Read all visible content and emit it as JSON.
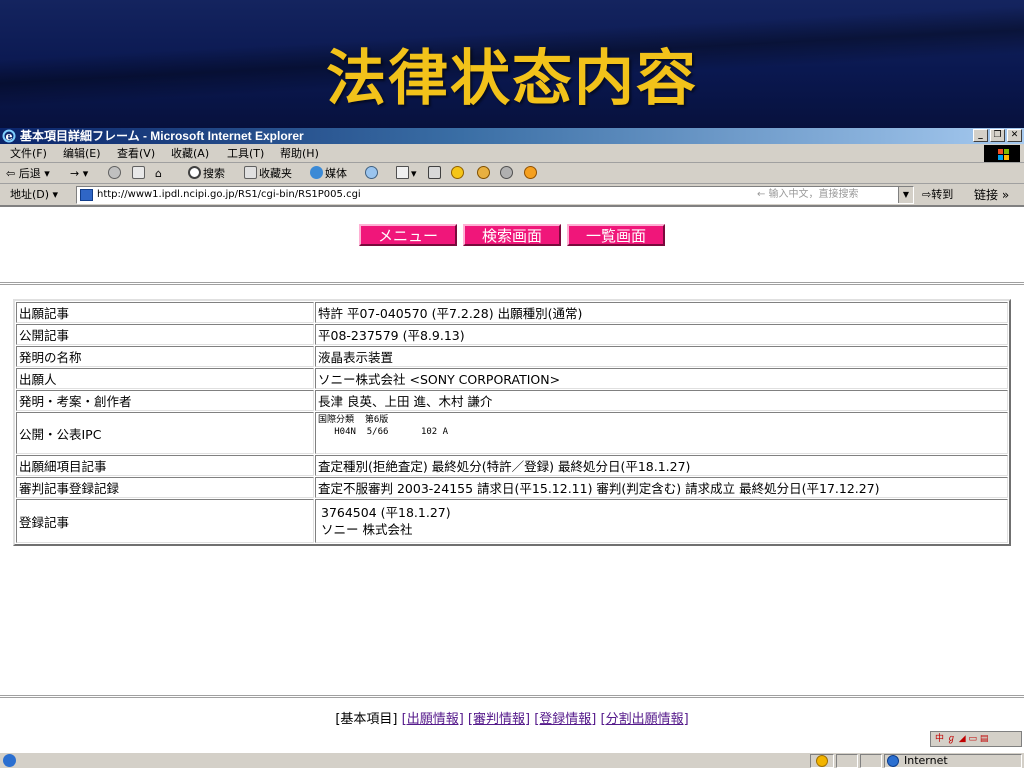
{
  "slide": {
    "title": "法律状态内容"
  },
  "window": {
    "title": "基本項目詳細フレーム - Microsoft Internet Explorer",
    "controls": {
      "minimize": "_",
      "restore": "❐",
      "close": "✕"
    }
  },
  "menubar": {
    "items": [
      "文件(F)",
      "编辑(E)",
      "查看(V)",
      "收藏(A)",
      "工具(T)",
      "帮助(H)"
    ]
  },
  "toolbar": {
    "back": "后退",
    "forward": "→",
    "search": "搜索",
    "favorites": "收藏夹",
    "media": "媒体"
  },
  "addressbar": {
    "label": "地址(D)",
    "url": "http://www1.ipdl.ncipi.go.jp/RS1/cgi-bin/RS1P005.cgi",
    "search_hint": "← 输入中文，直接搜索",
    "goto": "转到",
    "links": "链接 »"
  },
  "nav_buttons": [
    "メニュー",
    "検索画面",
    "一覧画面"
  ],
  "records": [
    {
      "label": "出願記事",
      "value": "特許 平07-040570 (平7.2.28) 出願種別(通常)"
    },
    {
      "label": "公開記事",
      "value": "平08-237579 (平8.9.13)"
    },
    {
      "label": "発明の名称",
      "value": "液晶表示装置"
    },
    {
      "label": "出願人",
      "value": "ソニー株式会社 <SONY CORPORATION>"
    },
    {
      "label": "発明・考案・創作者",
      "value": "長津 良英、上田 進、木村 謙介"
    }
  ],
  "ipc": {
    "label": "公開・公表IPC",
    "line1": "国際分類  第6版",
    "line2": "   H04N  5/66      102 A"
  },
  "records2": [
    {
      "label": "出願細項目記事",
      "value": "査定種別(拒絶査定) 最終処分(特許／登録) 最終処分日(平18.1.27)"
    },
    {
      "label": "審判記事登録記録",
      "value": "査定不服審判 2003-24155 請求日(平15.12.11) 審判(判定含む) 請求成立 最終処分日(平17.12.27)"
    }
  ],
  "registration": {
    "label": "登録記事",
    "line1": "3764504 (平18.1.27)",
    "line2": "ソニー 株式会社"
  },
  "bottom_nav": {
    "current": "[基本項目]",
    "links": [
      "[出願情報]",
      "[審判情報]",
      "[登録情報]",
      "[分割出願情報]"
    ]
  },
  "statusbar": {
    "zone": "Internet"
  },
  "colors": {
    "slide_title": "#f2c21a",
    "nav_button": "#f0167a",
    "titlebar": "#0a246a"
  }
}
